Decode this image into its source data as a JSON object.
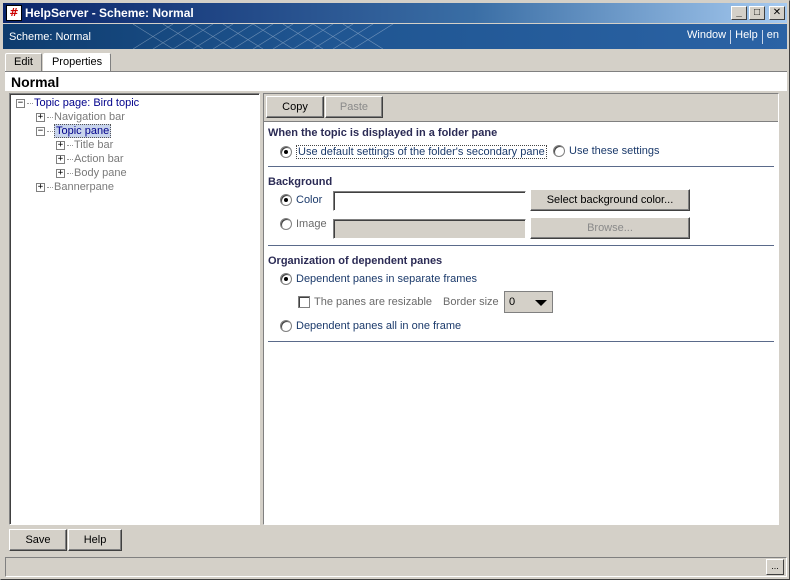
{
  "window": {
    "app_icon": "#",
    "title": "HelpServer - Scheme: Normal",
    "minimize": "_",
    "maximize": "□",
    "close": "✕"
  },
  "scheme_bar": {
    "label": "Scheme: Normal",
    "menu": [
      "Window",
      "Help",
      "en"
    ]
  },
  "tabs": [
    "Edit",
    "Properties"
  ],
  "active_tab": "Properties",
  "page_title": "Normal",
  "tree": {
    "root": "Topic page: Bird topic",
    "navigation_bar": "Navigation bar",
    "topic_pane": "Topic pane",
    "title_bar": "Title bar",
    "action_bar": "Action bar",
    "body_pane": "Body pane",
    "bannerpane": "Bannerpane"
  },
  "toolbar": {
    "copy": "Copy",
    "paste": "Paste"
  },
  "folder_pane": {
    "title": "When the topic is displayed in a folder pane",
    "option_default": "Use default settings of the folder's secondary pane",
    "option_custom": "Use these settings"
  },
  "background": {
    "title": "Background",
    "color_label": "Color",
    "image_label": "Image",
    "color_value": "",
    "image_value": "",
    "select_color_button": "Select background color...",
    "browse_button": "Browse..."
  },
  "organization": {
    "title": "Organization of dependent panes",
    "option_separate": "Dependent panes in separate frames",
    "resizable_label": "The panes are resizable",
    "border_size_label": "Border size",
    "border_size_value": "0",
    "option_one_frame": "Dependent panes all in one frame"
  },
  "footer": {
    "save": "Save",
    "help": "Help",
    "status_text": "",
    "status_button": "..."
  }
}
